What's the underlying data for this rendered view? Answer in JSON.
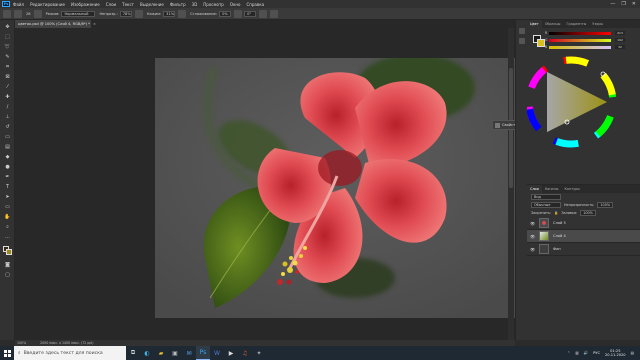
{
  "app": {
    "logo": "Ps"
  },
  "menu": [
    "Файл",
    "Редактирование",
    "Изображение",
    "Слои",
    "Текст",
    "Выделение",
    "Фильтр",
    "3D",
    "Просмотр",
    "Окно",
    "Справка"
  ],
  "window_controls": [
    "—",
    "❐",
    "✕"
  ],
  "options": {
    "size": "28",
    "mode_label": "Режим:",
    "mode_value": "Нормальный",
    "opacity_label": "Непрозр.:",
    "opacity_value": "78%",
    "flow_label": "Нажим:",
    "flow_value": "31%",
    "smoothing_label": "Сглаживание:",
    "smoothing_value": "0%",
    "angle_value": "0°"
  },
  "document_tab": {
    "title": "цветок.psd @ 100% (Слой 4, RGB/8*) *",
    "close": "×"
  },
  "status": {
    "zoom": "100%",
    "info": "2000 пикс. x 1400 пикс. (72 ppi)"
  },
  "properties": {
    "label": "Свойства"
  },
  "color_panel": {
    "tabs": [
      "Цвет",
      "Образцы",
      "Градиенты",
      "Узоры"
    ],
    "r_label": "R",
    "g_label": "G",
    "b_label": "B",
    "r_value": "213",
    "g_value": "192",
    "b_value": "32"
  },
  "layers_panel": {
    "tabs": [
      "Слои",
      "Каналы",
      "Контуры"
    ],
    "filter_label": "Вид",
    "blend_mode": "Обычные",
    "opacity_label": "Непрозрачность:",
    "opacity_value": "100%",
    "lock_label": "Закрепить:",
    "fill_label": "Заливка:",
    "fill_value": "100%",
    "layers": [
      {
        "name": "Слой 5",
        "selected": false
      },
      {
        "name": "Слой 4",
        "selected": true
      },
      {
        "name": "Фон",
        "selected": false
      }
    ]
  },
  "taskbar": {
    "search_placeholder": "Введите здесь текст для поиска",
    "apps": [
      "task-view-icon",
      "edge-icon",
      "explorer-icon",
      "store-icon",
      "mail-icon",
      "photoshop-icon",
      "word-icon",
      "media-icon",
      "music-icon",
      "tool-icon"
    ],
    "language": "РУС",
    "time": "01:25",
    "date": "20.11.2020"
  }
}
